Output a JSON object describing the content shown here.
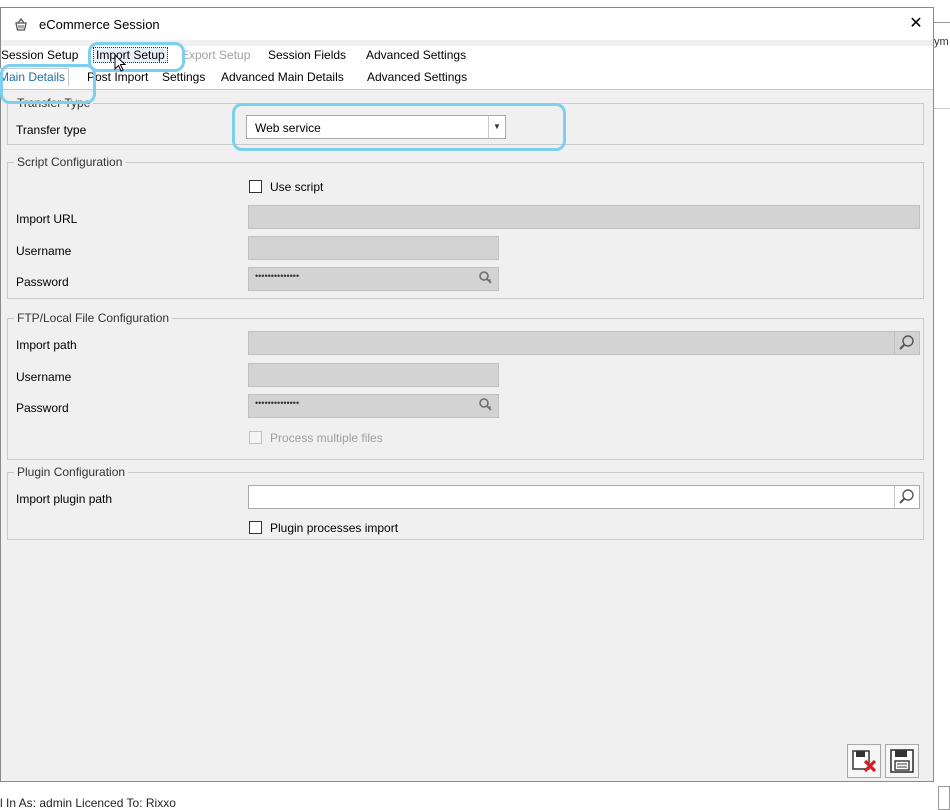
{
  "window": {
    "title": "eCommerce Session",
    "close_glyph": "✕"
  },
  "tabs_primary": [
    {
      "label": "Session Setup",
      "state": "normal"
    },
    {
      "label": "Import Setup",
      "state": "selected"
    },
    {
      "label": "Export Setup",
      "state": "disabled"
    },
    {
      "label": "Session Fields",
      "state": "normal"
    },
    {
      "label": "Advanced Settings",
      "state": "normal"
    }
  ],
  "tabs_secondary": [
    {
      "label": "Main Details",
      "state": "active"
    },
    {
      "label": "Post Import",
      "state": "normal"
    },
    {
      "label": "Settings",
      "state": "normal"
    },
    {
      "label": "Advanced Main Details",
      "state": "normal"
    },
    {
      "label": "Advanced Settings",
      "state": "normal"
    }
  ],
  "transfer_type": {
    "legend": "Transfer Type",
    "label": "Transfer type",
    "selected": "Web service"
  },
  "script_config": {
    "legend": "Script Configuration",
    "use_script_label": "Use script",
    "use_script_checked": false,
    "import_url_label": "Import URL",
    "import_url_value": "",
    "username_label": "Username",
    "username_value": "",
    "password_label": "Password",
    "password_mask": "••••••••••••••"
  },
  "ftp_config": {
    "legend": "FTP/Local File Configuration",
    "import_path_label": "Import path",
    "import_path_value": "",
    "username_label": "Username",
    "username_value": "",
    "password_label": "Password",
    "password_mask": "••••••••••••••",
    "process_multiple_label": "Process multiple files",
    "process_multiple_checked": false
  },
  "plugin_config": {
    "legend": "Plugin Configuration",
    "import_plugin_label": "Import plugin path",
    "import_plugin_value": "",
    "plugin_processes_label": "Plugin processes import",
    "plugin_processes_checked": false
  },
  "status_bar": {
    "text": "l In As: admin  Licenced To: Rixxo"
  },
  "colors": {
    "highlight": "#7cd0ee",
    "active_tab_text": "#1a6fb5",
    "window_bg": "#f0f0f0",
    "readonly_field": "#d3d3d3"
  }
}
